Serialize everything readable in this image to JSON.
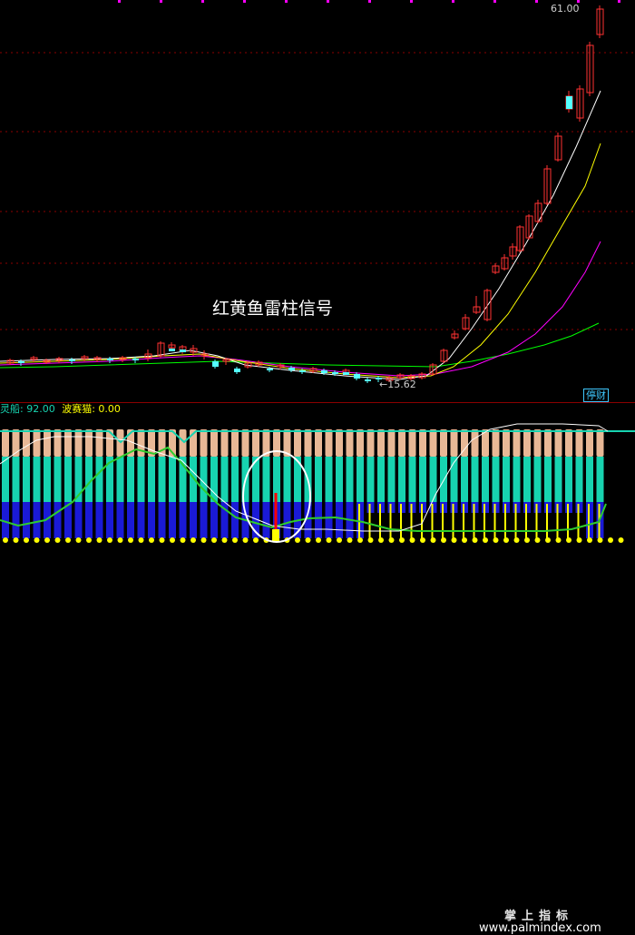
{
  "chart": {
    "high_label": "61.00",
    "low_label": "←15.62",
    "annotation": "红黄鱼雷柱信号",
    "stop_badge": "停财"
  },
  "indicator": {
    "name_prefix": "灵船: ",
    "name_value": "92.00",
    "cat_prefix": "波赛猫: ",
    "cat_value": "0.00"
  },
  "watermark": {
    "brand": "掌上指标",
    "url": "www.palmindex.com"
  },
  "colors": {
    "background": "#000000",
    "up": "#ff3232",
    "down": "#54ffff",
    "ma_white": "#ffffff",
    "ma_yellow": "#ffff00",
    "ma_magenta": "#ff00ff",
    "ma_green": "#00ff00",
    "bar_tan": "#e8b896",
    "bar_teal": "#17d3b0",
    "bar_blue": "#1a1ad6",
    "signal_yellow": "#ffff00"
  },
  "chart_data": {
    "type": "candlestick",
    "y_high": 61.0,
    "y_low": 15.62
  }
}
